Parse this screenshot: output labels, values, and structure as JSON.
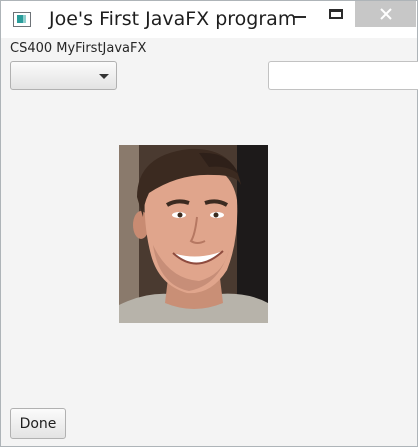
{
  "window": {
    "title": "Joe's First JavaFX program"
  },
  "content": {
    "heading": "CS400 MyFirstJavaFX",
    "combo_value": "",
    "text_field_value": "",
    "image_description": "portrait-photo",
    "done_button_label": "Done"
  },
  "colors": {
    "window_bg": "#f4f4f4",
    "titlebar_bg": "#ffffff",
    "close_button_bg": "#c7c7c7"
  },
  "icons": {
    "app": "javafx-window-icon",
    "minimize": "minimize-icon",
    "maximize": "maximize-icon",
    "close": "close-icon",
    "dropdown": "chevron-down-icon"
  }
}
